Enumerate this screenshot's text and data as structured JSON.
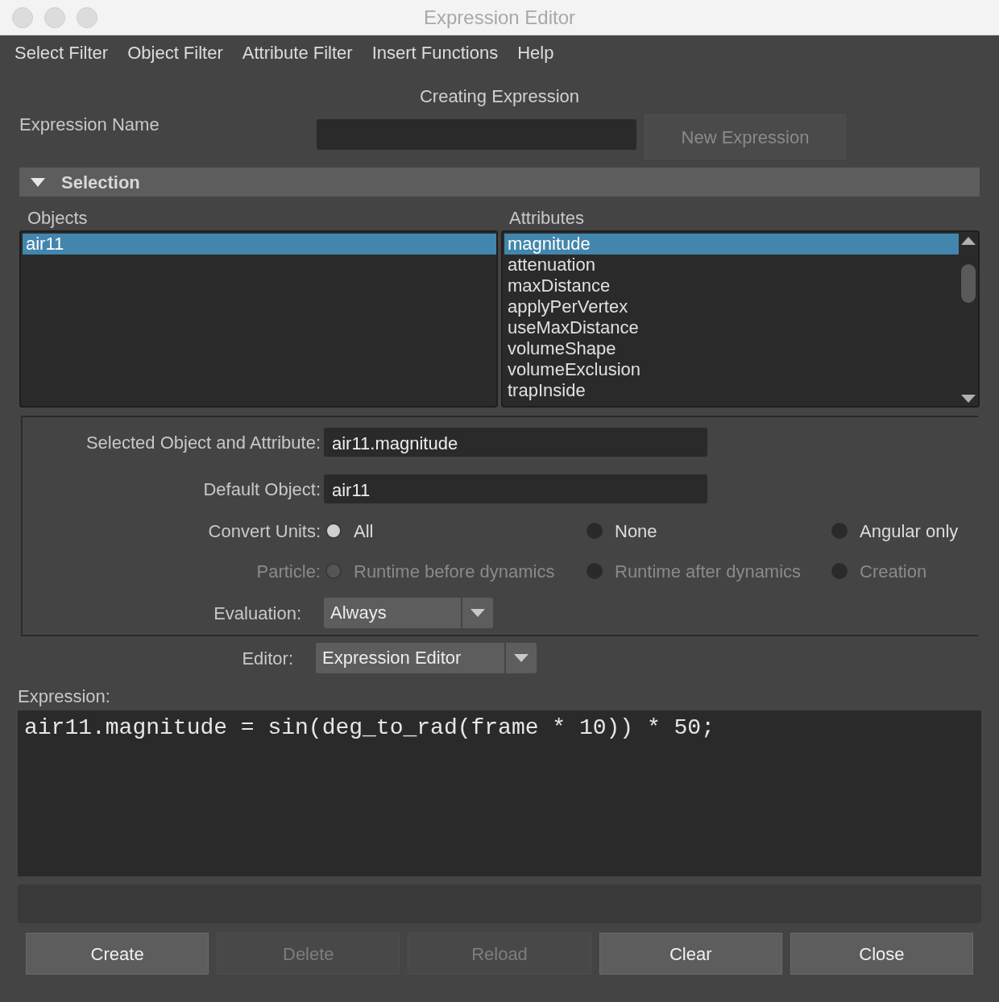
{
  "window": {
    "title": "Expression Editor"
  },
  "menu": [
    "Select Filter",
    "Object Filter",
    "Attribute Filter",
    "Insert Functions",
    "Help"
  ],
  "heading": "Creating Expression",
  "expression_name": {
    "label": "Expression Name",
    "button": {
      "label": "New Expression",
      "disabled": true
    }
  },
  "section": {
    "title": "Selection",
    "expanded": true
  },
  "objects": {
    "label": "Objects",
    "items": [
      {
        "text": "air11",
        "selected": true
      }
    ]
  },
  "attributes": {
    "label": "Attributes",
    "items": [
      {
        "text": "magnitude",
        "selected": true
      },
      {
        "text": "attenuation",
        "selected": false
      },
      {
        "text": "maxDistance",
        "selected": false
      },
      {
        "text": "applyPerVertex",
        "selected": false
      },
      {
        "text": "useMaxDistance",
        "selected": false
      },
      {
        "text": "volumeShape",
        "selected": false
      },
      {
        "text": "volumeExclusion",
        "selected": false
      },
      {
        "text": "trapInside",
        "selected": false
      }
    ]
  },
  "fields": [
    {
      "label": "Selected Object and Attribute:",
      "value": "air11.magnitude"
    },
    {
      "label": "Default Object:",
      "value": "air11"
    }
  ],
  "radio_groups": [
    {
      "label": "Convert Units:",
      "disabled": false,
      "options": [
        {
          "label": "All",
          "selected": true
        },
        {
          "label": "None",
          "selected": false
        },
        {
          "label": "Angular only",
          "selected": false
        }
      ]
    },
    {
      "label": "Particle:",
      "disabled": true,
      "options": [
        {
          "label": "Runtime before dynamics",
          "selected": true
        },
        {
          "label": "Runtime after dynamics",
          "selected": false
        },
        {
          "label": "Creation",
          "selected": false
        }
      ]
    }
  ],
  "evaluation": {
    "label": "Evaluation:",
    "value": "Always"
  },
  "editor": {
    "label": "Editor:",
    "value": "Expression Editor"
  },
  "expression": {
    "label": "Expression:",
    "code": "air11.magnitude = sin(deg_to_rad(frame * 10)) * 50;"
  },
  "buttons": [
    {
      "label": "Create",
      "disabled": false
    },
    {
      "label": "Delete",
      "disabled": true
    },
    {
      "label": "Reload",
      "disabled": true
    },
    {
      "label": "Clear",
      "disabled": false
    },
    {
      "label": "Close",
      "disabled": false
    }
  ]
}
